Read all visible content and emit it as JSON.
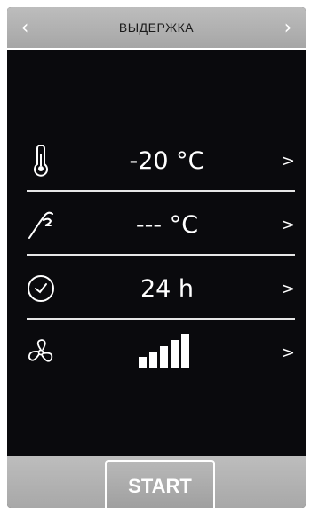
{
  "header": {
    "title": "ВЫДЕРЖКА",
    "prev_glyph": "‹",
    "next_glyph": "›"
  },
  "settings": [
    {
      "icon": "thermometer-icon",
      "value": "-20 °C",
      "chevron": ">"
    },
    {
      "icon": "probe-icon",
      "value": "--- °C",
      "chevron": ">"
    },
    {
      "icon": "clock-icon",
      "value": "24 h",
      "chevron": ">"
    },
    {
      "icon": "fan-icon",
      "value": "",
      "fan_level_bars": 5,
      "chevron": ">"
    }
  ],
  "footer": {
    "start_label": "START"
  },
  "colors": {
    "background": "#0a0a0d",
    "bar": "#b0b0b0",
    "text": "#ffffff"
  }
}
